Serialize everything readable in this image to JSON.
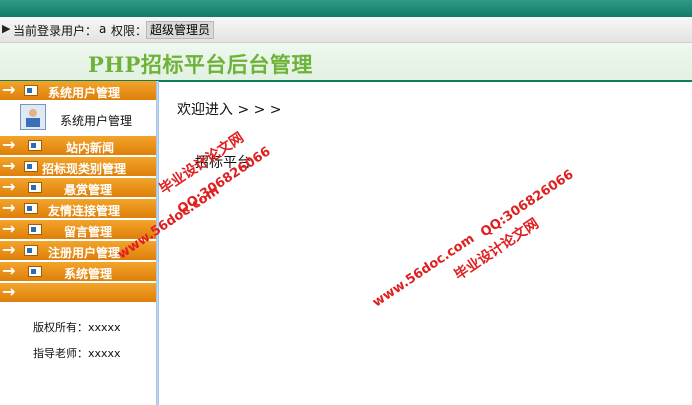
{
  "header": {
    "login_label": "当前登录用户：",
    "user": "a",
    "role_label": "权限：",
    "role_value": "超级管理员"
  },
  "banner": {
    "title": "PHP招标平台后台管理"
  },
  "sidebar": {
    "items": [
      {
        "label": "系统用户管理"
      },
      {
        "label": "站内新闻"
      },
      {
        "label": "招标现类别管理"
      },
      {
        "label": "悬赏管理"
      },
      {
        "label": "友情连接管理"
      },
      {
        "label": "留言管理"
      },
      {
        "label": "注册用户管理"
      },
      {
        "label": "系统管理"
      }
    ],
    "submenu": {
      "label": "系统用户管理"
    },
    "footer": {
      "copyright": "版权所有：xxxxx",
      "teacher": "指导老师：xxxxx"
    }
  },
  "main": {
    "welcome": "欢迎进入 > > >",
    "platform": "招标平台"
  },
  "watermarks": {
    "site": "www.56doc.com",
    "qq": "QQ:306826066",
    "name": "毕业设计论文网"
  },
  "colors": {
    "menu_orange": "#e88a14",
    "title_green": "#6fb23a",
    "topbar_teal": "#137a69"
  }
}
